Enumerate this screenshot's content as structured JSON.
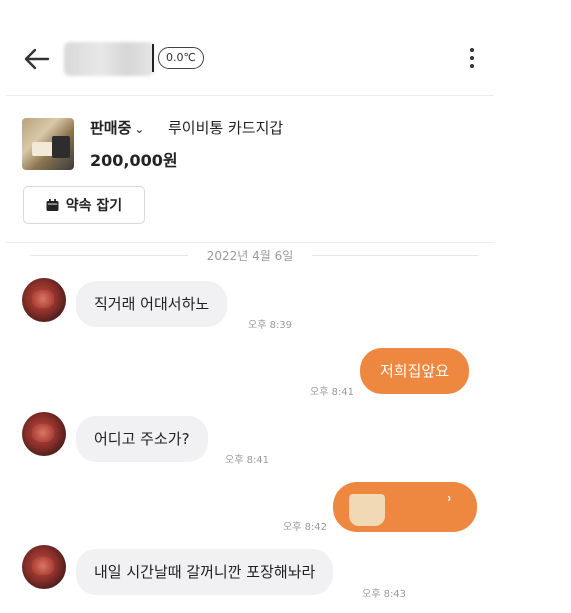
{
  "header": {
    "back_icon": "arrow-left-icon",
    "user_name": "",
    "temperature": "0.0℃",
    "more_icon": "vertical-dots-icon"
  },
  "product": {
    "status": "판매중",
    "status_chevron": "⌄",
    "title": "루이비통 카드지갑",
    "price": "200,000원",
    "appointment_button": "약속 잡기",
    "appointment_icon": "calendar-icon"
  },
  "chat": {
    "date": "2022년 4월 6일",
    "messages": [
      {
        "direction": "in",
        "text": "직거래 어대서하노",
        "time": "오후 8:39"
      },
      {
        "direction": "out",
        "text": "저희집앞요",
        "time": "오후 8:41"
      },
      {
        "direction": "in",
        "text": "어디고 주소가?",
        "time": "오후 8:41"
      },
      {
        "direction": "out",
        "text": "",
        "time": "오후 8:42",
        "kind": "image"
      },
      {
        "direction": "in",
        "text": "내일 시간날때 갈꺼니깐 포장해놔라",
        "time": "오후 8:43"
      }
    ]
  },
  "colors": {
    "accent": "#ee8740",
    "incoming_bubble": "#f1f1f3",
    "divider": "#ececec"
  }
}
